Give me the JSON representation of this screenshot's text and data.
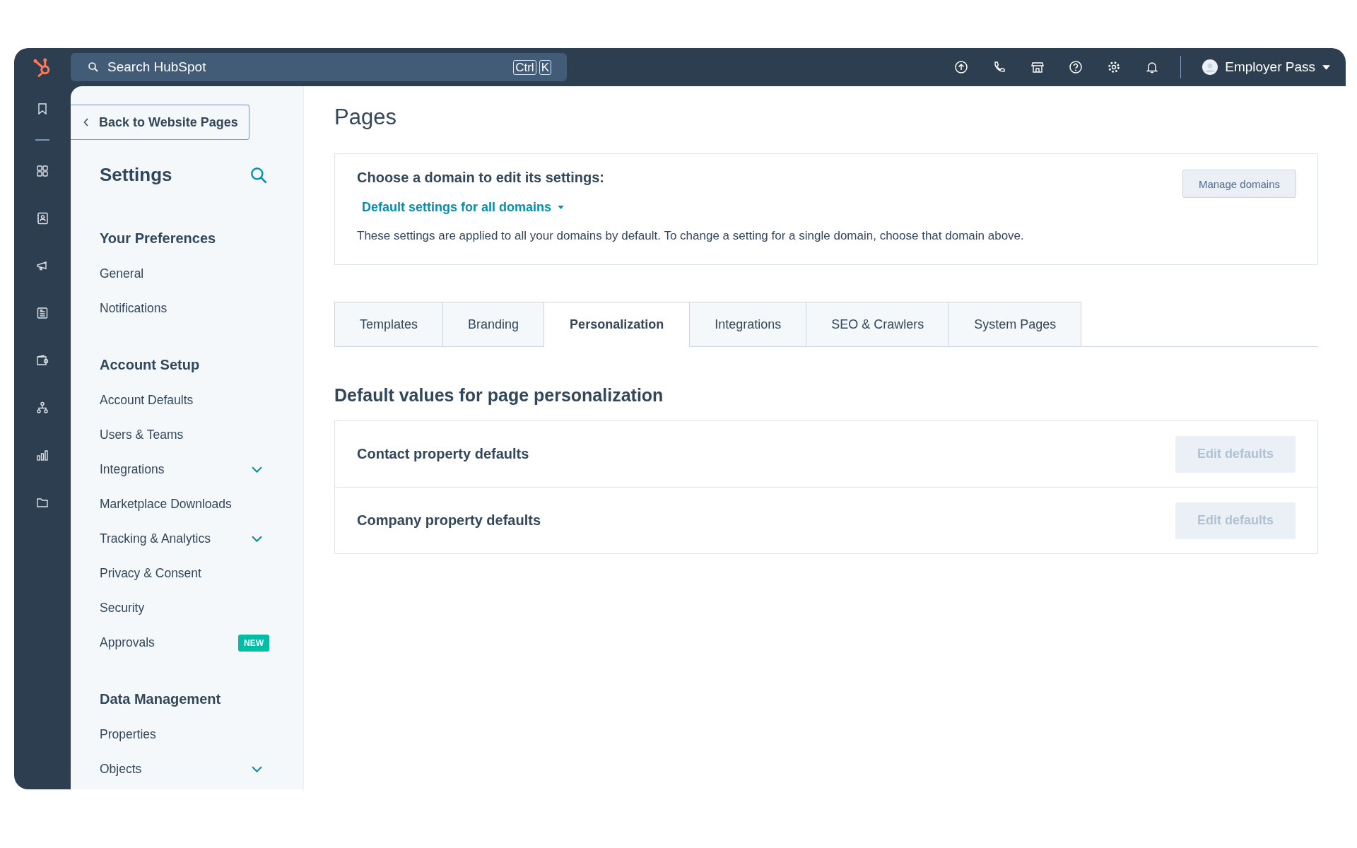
{
  "top_bar": {
    "search": {
      "placeholder": "Search HubSpot",
      "shortcut_keys": [
        "Ctrl",
        "K"
      ]
    },
    "account": {
      "name": "Employer Pass"
    }
  },
  "sidebar": {
    "back_link": "Back to Website Pages",
    "title": "Settings",
    "sections": [
      {
        "heading": "Your Preferences",
        "items": [
          {
            "label": "General",
            "expandable": false
          },
          {
            "label": "Notifications",
            "expandable": false
          }
        ]
      },
      {
        "heading": "Account Setup",
        "items": [
          {
            "label": "Account Defaults",
            "expandable": false
          },
          {
            "label": "Users & Teams",
            "expandable": false
          },
          {
            "label": "Integrations",
            "expandable": true
          },
          {
            "label": "Marketplace Downloads",
            "expandable": false
          },
          {
            "label": "Tracking & Analytics",
            "expandable": true
          },
          {
            "label": "Privacy & Consent",
            "expandable": false
          },
          {
            "label": "Security",
            "expandable": false
          },
          {
            "label": "Approvals",
            "expandable": false,
            "badge": "NEW"
          }
        ]
      },
      {
        "heading": "Data Management",
        "items": [
          {
            "label": "Properties",
            "expandable": false
          },
          {
            "label": "Objects",
            "expandable": true
          }
        ]
      }
    ]
  },
  "page": {
    "title": "Pages",
    "domain_card": {
      "heading": "Choose a domain to edit its settings:",
      "domain_dropdown": "Default settings for all domains",
      "description": "These settings are applied to all your domains by default. To change a setting for a single domain, choose that domain above.",
      "button": "Manage domains"
    },
    "tabs": [
      {
        "label": "Templates",
        "selected": false
      },
      {
        "label": "Branding",
        "selected": false
      },
      {
        "label": "Personalization",
        "selected": true
      },
      {
        "label": "Integrations",
        "selected": false
      },
      {
        "label": "SEO & Crawlers",
        "selected": false
      },
      {
        "label": "System Pages",
        "selected": false
      }
    ],
    "section_title": "Default values for page personalization",
    "rows": [
      {
        "label": "Contact property defaults",
        "button": "Edit defaults",
        "disabled": true
      },
      {
        "label": "Company property defaults",
        "button": "Edit defaults",
        "disabled": true
      }
    ]
  }
}
